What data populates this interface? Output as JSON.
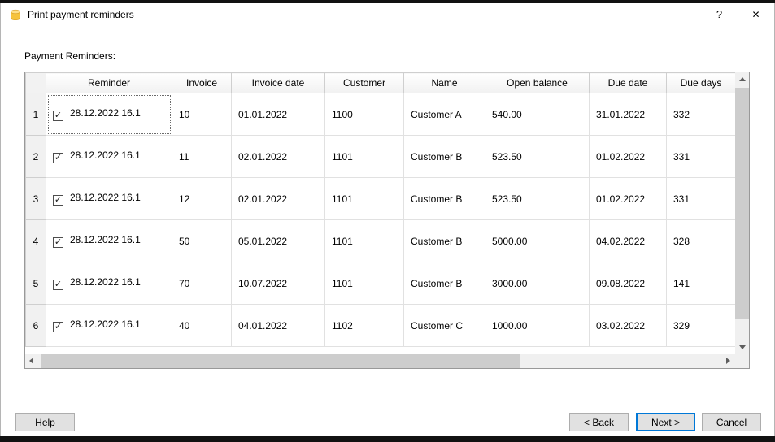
{
  "window": {
    "title": "Print payment reminders",
    "help_glyph": "?",
    "close_glyph": "✕"
  },
  "content": {
    "label": "Payment Reminders:"
  },
  "table": {
    "headers": [
      "Reminder",
      "Invoice",
      "Invoice date",
      "Customer",
      "Name",
      "Open balance",
      "Due date",
      "Due days"
    ],
    "rows": [
      {
        "num": "1",
        "checked": true,
        "reminder": "28.12.2022 16.1",
        "invoice": "10",
        "invoice_date": "01.01.2022",
        "customer": "1100",
        "name": "Customer A",
        "open_balance": "540.00",
        "due_date": "31.01.2022",
        "due_days": "332"
      },
      {
        "num": "2",
        "checked": true,
        "reminder": "28.12.2022 16.1",
        "invoice": "11",
        "invoice_date": "02.01.2022",
        "customer": "1101",
        "name": "Customer B",
        "open_balance": "523.50",
        "due_date": "01.02.2022",
        "due_days": "331"
      },
      {
        "num": "3",
        "checked": true,
        "reminder": "28.12.2022 16.1",
        "invoice": "12",
        "invoice_date": "02.01.2022",
        "customer": "1101",
        "name": "Customer B",
        "open_balance": "523.50",
        "due_date": "01.02.2022",
        "due_days": "331"
      },
      {
        "num": "4",
        "checked": true,
        "reminder": "28.12.2022 16.1",
        "invoice": "50",
        "invoice_date": "05.01.2022",
        "customer": "1101",
        "name": "Customer B",
        "open_balance": "5000.00",
        "due_date": "04.02.2022",
        "due_days": "328"
      },
      {
        "num": "5",
        "checked": true,
        "reminder": "28.12.2022 16.1",
        "invoice": "70",
        "invoice_date": "10.07.2022",
        "customer": "1101",
        "name": "Customer B",
        "open_balance": "3000.00",
        "due_date": "09.08.2022",
        "due_days": "141"
      },
      {
        "num": "6",
        "checked": true,
        "reminder": "28.12.2022 16.1",
        "invoice": "40",
        "invoice_date": "04.01.2022",
        "customer": "1102",
        "name": "Customer C",
        "open_balance": "1000.00",
        "due_date": "03.02.2022",
        "due_days": "329"
      }
    ]
  },
  "buttons": {
    "help": "Help",
    "back": "< Back",
    "next": "Next >",
    "cancel": "Cancel"
  }
}
